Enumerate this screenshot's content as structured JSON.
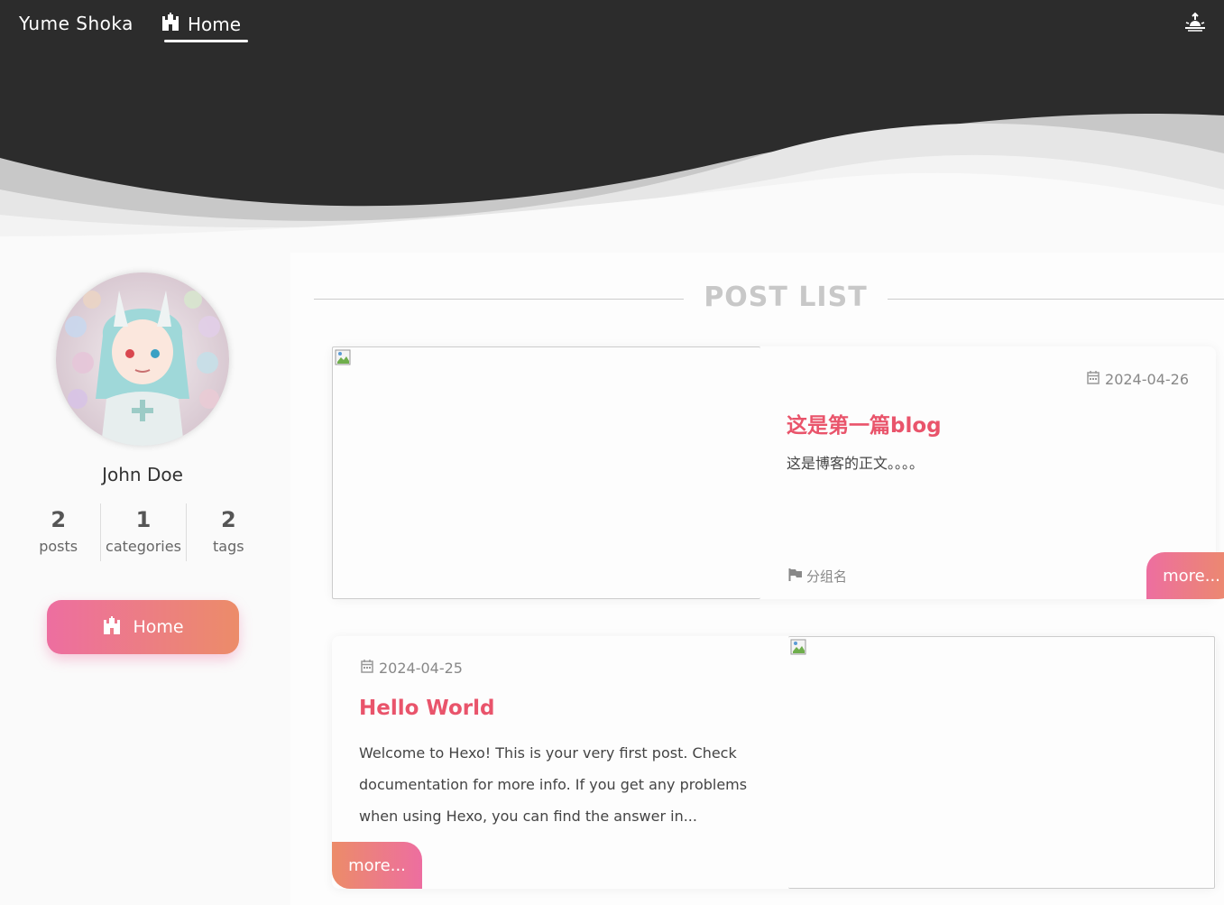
{
  "site": {
    "brand": "Yume Shoka",
    "nav_home": "Home",
    "icons": {
      "home": "castle-icon",
      "theme": "sunrise-icon"
    },
    "colors": {
      "header_bg": "#2c2c2c",
      "accent_start": "#ed6ea0",
      "accent_end": "#ec8c69",
      "title_color": "#e9546b"
    }
  },
  "sidebar": {
    "author": "John Doe",
    "stats": [
      {
        "num": "2",
        "label": "posts"
      },
      {
        "num": "1",
        "label": "categories"
      },
      {
        "num": "2",
        "label": "tags"
      }
    ],
    "home_button": "Home"
  },
  "main": {
    "section_title": "POST LIST",
    "posts": [
      {
        "date": "2024-04-26",
        "title": "这是第一篇blog",
        "excerpt": "这是博客的正文。。。。",
        "category": "分组名",
        "more": "more..."
      },
      {
        "date": "2024-04-25",
        "title": "Hello World",
        "excerpt": "Welcome to Hexo! This is your very first post. Check documentation for more info. If you get any problems when using Hexo, you can find the answer in...",
        "more": "more..."
      }
    ]
  }
}
